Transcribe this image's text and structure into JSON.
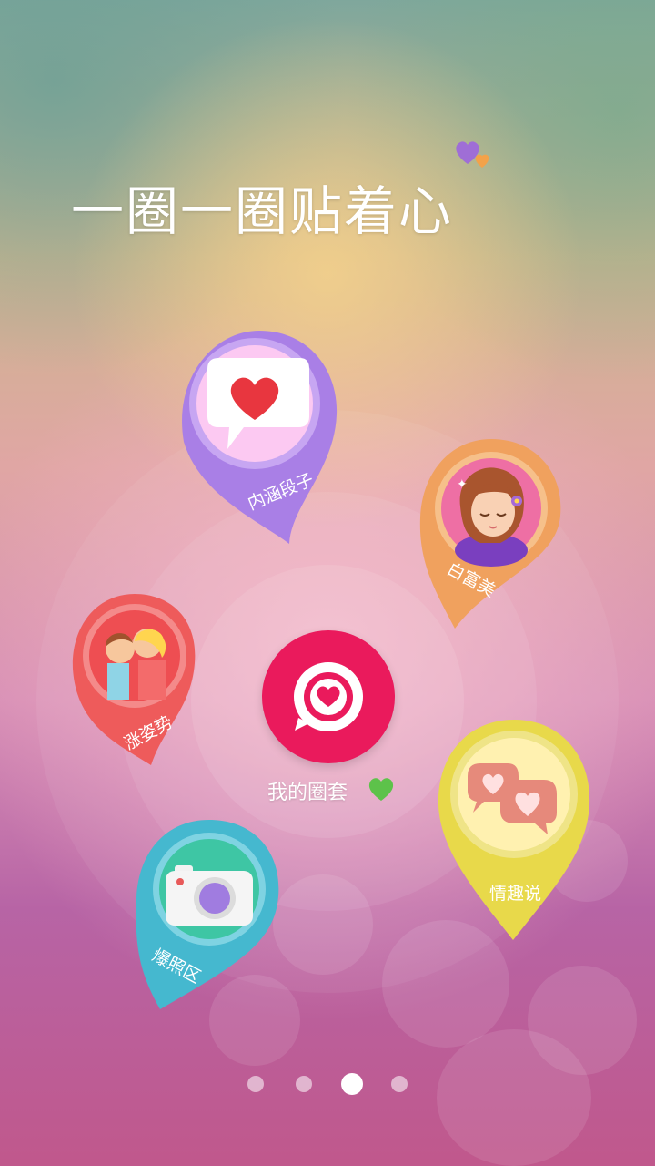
{
  "title": "一圈一圈贴着心",
  "center": {
    "label": "我的圈套"
  },
  "pins": [
    {
      "id": "neihan",
      "label": "内涵段子",
      "icon": "heart-speech-bubble-icon",
      "color": "#a97fe6"
    },
    {
      "id": "baifumei",
      "label": "白富美",
      "icon": "girl-avatar-icon",
      "color": "#f0a15e"
    },
    {
      "id": "zhangzishi",
      "label": "涨姿势",
      "icon": "kissing-couple-icon",
      "color": "#ee5b5b"
    },
    {
      "id": "qingqushuo",
      "label": "情趣说",
      "icon": "chat-hearts-icon",
      "color": "#e8d94a"
    },
    {
      "id": "baozhaoqu",
      "label": "爆照区",
      "icon": "camera-icon",
      "color": "#45b8cf"
    }
  ],
  "pagination": {
    "total": 4,
    "active_index": 2
  }
}
